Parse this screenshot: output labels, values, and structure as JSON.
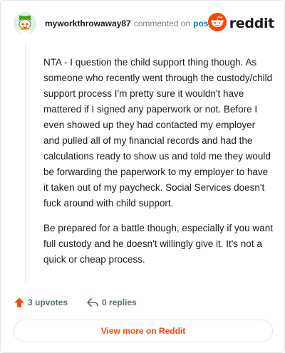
{
  "header": {
    "username": "myworkthrowaway87",
    "action_text": "commented on",
    "post_link": "post",
    "brand": "reddit"
  },
  "comment": {
    "paragraphs": [
      "NTA - I question the child support thing though. As someone who recently went through the custody/child support process I'm pretty sure it wouldn't have mattered if I signed any paperwork or not. Before I even showed up they had contacted my employer and pulled all of my financial records and had the calculations ready to show us and told me they would be forwarding the paperwork to my employer to have it taken out of my paycheck. Social Services doesn't fuck around with child support.",
      "Be prepared for a battle though, especially if you want full custody and he doesn't willingly give it. It's not a quick or cheap process."
    ]
  },
  "actions": {
    "upvotes_label": "3 upvotes",
    "replies_label": "0 replies"
  },
  "footer": {
    "view_more_label": "View more on Reddit"
  },
  "colors": {
    "brand": "#ff4500",
    "link": "#0079d3",
    "muted": "#576f76",
    "avatar_bg": "#dff3e4"
  },
  "icons": {
    "avatar": "snoo-avatar-icon",
    "logo": "reddit-logo-icon",
    "upvote": "upvote-arrow-icon",
    "reply": "reply-arrow-icon"
  }
}
